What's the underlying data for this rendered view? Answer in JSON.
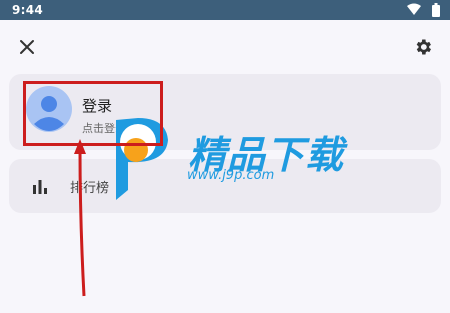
{
  "status_bar": {
    "time": "9:44"
  },
  "icons": {
    "close": "close-icon",
    "settings": "gear-icon",
    "avatar": "person-icon",
    "rank": "bar-chart-icon",
    "wifi": "wifi-icon",
    "battery": "battery-icon"
  },
  "account": {
    "title": "登录",
    "subtitle": "点击登录"
  },
  "rank": {
    "label": "排行榜"
  },
  "watermark": {
    "brand": "精品下载",
    "url": "www.j9p.com"
  },
  "colors": {
    "status_bar": "#3d5f7b",
    "highlight": "#cc1d1d",
    "watermark": "#1f9be0"
  }
}
